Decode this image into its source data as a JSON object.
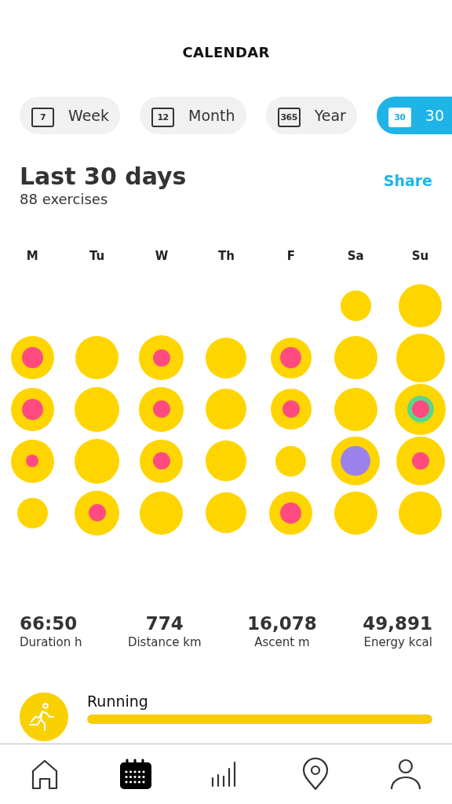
{
  "header": {
    "title": "CALENDAR"
  },
  "tabs": [
    {
      "label": "Week",
      "icon_text": "7",
      "selected": false
    },
    {
      "label": "Month",
      "icon_text": "12",
      "selected": false
    },
    {
      "label": "Year",
      "icon_text": "365",
      "selected": false
    },
    {
      "label": "30",
      "icon_text": "30",
      "selected": true
    }
  ],
  "summary": {
    "title": "Last 30 days",
    "subtitle": "88 exercises",
    "share": "Share"
  },
  "weekdays": [
    "M",
    "Tu",
    "W",
    "Th",
    "F",
    "Sa",
    "Su"
  ],
  "weeks": [
    [
      {
        "kind": "xs"
      },
      {
        "kind": "m"
      }
    ],
    [
      {
        "kind": "m",
        "inner": {
          "color": "#ff4b7f",
          "kind": "m"
        }
      },
      {
        "kind": "m"
      },
      {
        "kind": "l",
        "inner": {
          "color": "#ff4b7f",
          "kind": "s"
        }
      },
      {
        "kind": "s"
      },
      {
        "kind": "s",
        "inner": {
          "color": "#ff4b7f",
          "kind": "m"
        }
      },
      {
        "kind": "m"
      },
      {
        "kind": "xl"
      }
    ],
    [
      {
        "kind": "m",
        "inner": {
          "color": "#ff4b7f",
          "kind": "m"
        }
      },
      {
        "kind": "l"
      },
      {
        "kind": "l",
        "inner": {
          "color": "#ff4b7f",
          "kind": "s"
        }
      },
      {
        "kind": "s"
      },
      {
        "kind": "s",
        "inner": {
          "color": "#ff4b7f",
          "kind": "s"
        }
      },
      {
        "kind": "m"
      },
      {
        "kind": "xxl",
        "ring": {
          "color": "#5cd68a"
        },
        "inner": {
          "color": "#ff4b7f",
          "kind": "s"
        }
      }
    ],
    [
      {
        "kind": "m",
        "inner": {
          "color": "#ff4b7f",
          "kind": "xs"
        }
      },
      {
        "kind": "l"
      },
      {
        "kind": "m",
        "inner": {
          "color": "#ff4b7f",
          "kind": "s"
        }
      },
      {
        "kind": "s"
      },
      {
        "kind": "xs"
      },
      {
        "kind": "xl",
        "inner": {
          "color": "#9b82ea",
          "kind": "l"
        }
      },
      {
        "kind": "xl",
        "inner": {
          "color": "#ff4b7f",
          "kind": "s"
        }
      }
    ],
    [
      {
        "kind": "xs"
      },
      {
        "kind": "l",
        "inner": {
          "color": "#ff4b7f",
          "kind": "s"
        }
      },
      {
        "kind": "m"
      },
      {
        "kind": "s"
      },
      {
        "kind": "m",
        "inner": {
          "color": "#ff4b7f",
          "kind": "m"
        }
      },
      {
        "kind": "m"
      },
      {
        "kind": "m"
      }
    ]
  ],
  "stats": [
    {
      "value": "66:50",
      "label": "Duration h"
    },
    {
      "value": "774",
      "label": "Distance km"
    },
    {
      "value": "16,078",
      "label": "Ascent m"
    },
    {
      "value": "49,891",
      "label": "Energy kcal"
    }
  ],
  "activities": [
    {
      "name": "Running",
      "level": 1
    }
  ],
  "nav": [
    {
      "kind": "home",
      "selected": false
    },
    {
      "kind": "calendar",
      "selected": true
    },
    {
      "kind": "stats",
      "selected": false
    },
    {
      "kind": "map",
      "selected": false
    },
    {
      "kind": "profile",
      "selected": false
    }
  ]
}
